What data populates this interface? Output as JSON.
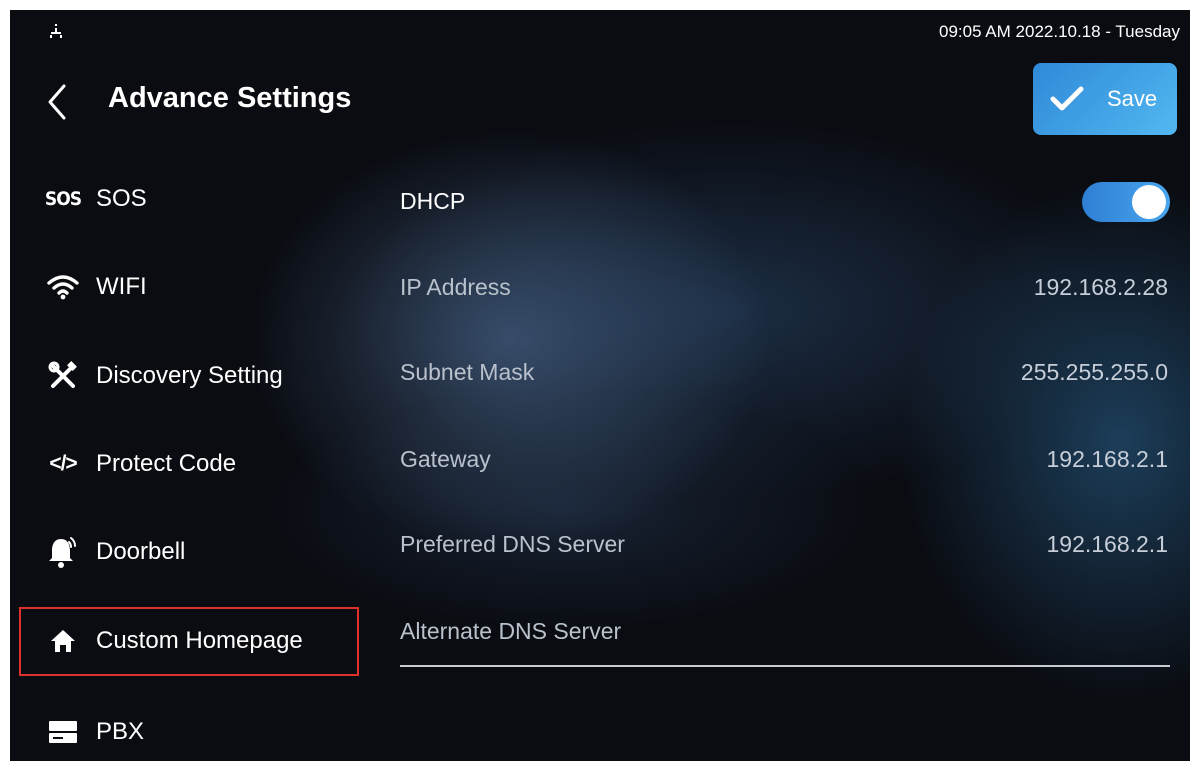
{
  "status_bar": {
    "time": "09:05 AM  2022.10.18 - Tuesday",
    "network_icon": "network-icon"
  },
  "header": {
    "title": "Advance Settings",
    "back_icon": "chevron-left-icon",
    "save_label": "Save",
    "save_icon": "check-icon"
  },
  "sidebar": {
    "items": [
      {
        "label": "SOS",
        "icon": "sos-icon",
        "icon_text": "SOS"
      },
      {
        "label": "WIFI",
        "icon": "wifi-icon"
      },
      {
        "label": "Discovery Setting",
        "icon": "tools-icon"
      },
      {
        "label": "Protect Code",
        "icon": "code-icon",
        "icon_text": "</>"
      },
      {
        "label": "Doorbell",
        "icon": "bell-icon"
      },
      {
        "label": "Custom Homepage",
        "icon": "home-icon",
        "selected": true
      },
      {
        "label": "PBX",
        "icon": "pbx-icon"
      }
    ]
  },
  "network": {
    "dhcp": {
      "label": "DHCP",
      "enabled": true
    },
    "fields": [
      {
        "label": "IP Address",
        "value": "192.168.2.28"
      },
      {
        "label": "Subnet Mask",
        "value": "255.255.255.0"
      },
      {
        "label": "Gateway",
        "value": "192.168.2.1"
      },
      {
        "label": "Preferred DNS Server",
        "value": "192.168.2.1"
      },
      {
        "label": "Alternate DNS Server",
        "value": ""
      }
    ]
  },
  "colors": {
    "accent": "#3a95e3",
    "highlight_border": "#e0302b",
    "background": "#0a0c12"
  }
}
